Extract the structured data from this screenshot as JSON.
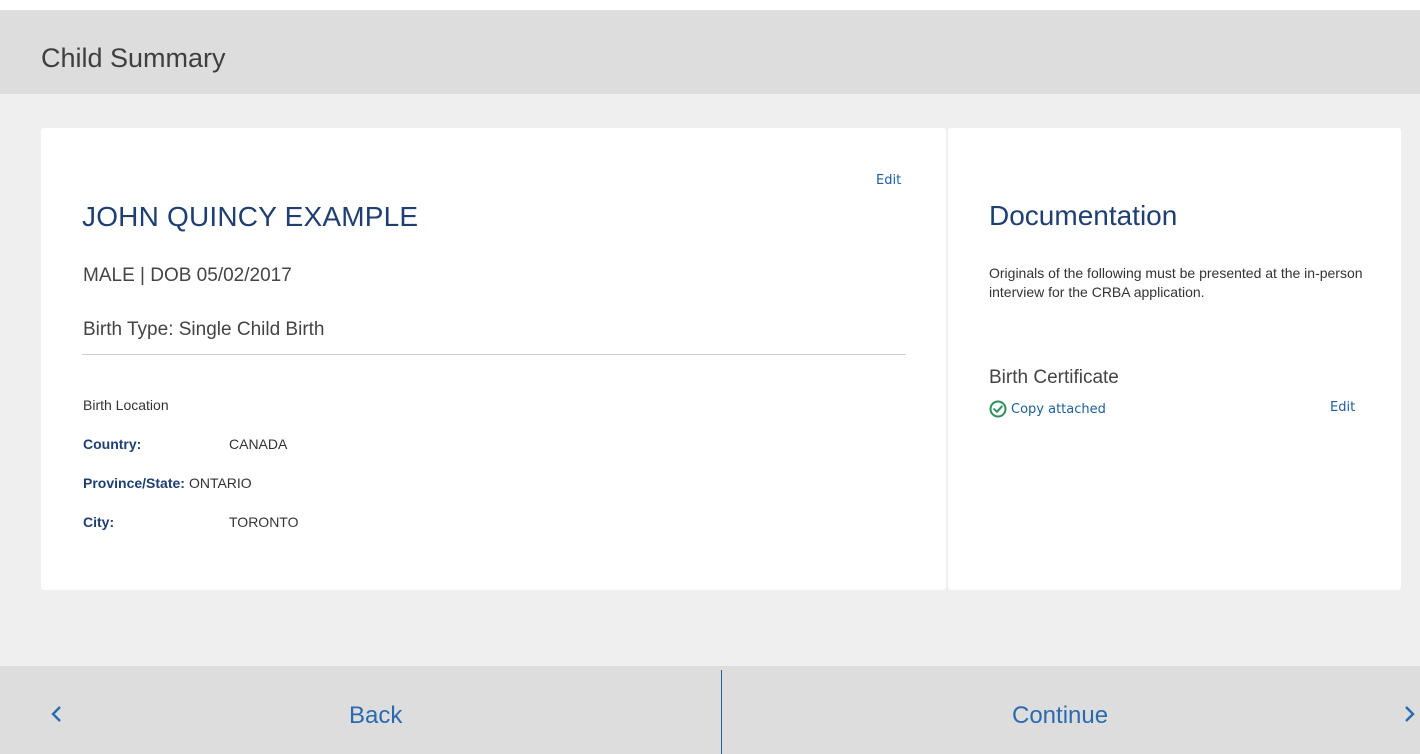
{
  "header": {
    "title": "Child Summary"
  },
  "child": {
    "edit_label": "Edit",
    "name": "JOHN QUINCY EXAMPLE",
    "meta": "MALE | DOB 05/02/2017",
    "birth_type": "Birth Type: Single Child Birth",
    "birth_location": {
      "heading": "Birth Location",
      "country_label": "Country:",
      "country_value": "CANADA",
      "province_label": "Province/State:",
      "province_value": "ONTARIO",
      "city_label": "City:",
      "city_value": "TORONTO"
    }
  },
  "documentation": {
    "title": "Documentation",
    "description": "Originals of the following must be presented at the in-person interview for the CRBA application.",
    "items": [
      {
        "name": "Birth Certificate",
        "status": "Copy attached",
        "status_icon": "check-circle-icon",
        "edit_label": "Edit"
      }
    ]
  },
  "footer": {
    "back_label": "Back",
    "continue_label": "Continue"
  },
  "colors": {
    "accent": "#1d5fa0",
    "heading": "#1f3f72",
    "background": "#efefef",
    "header_bg": "#dddddd"
  }
}
